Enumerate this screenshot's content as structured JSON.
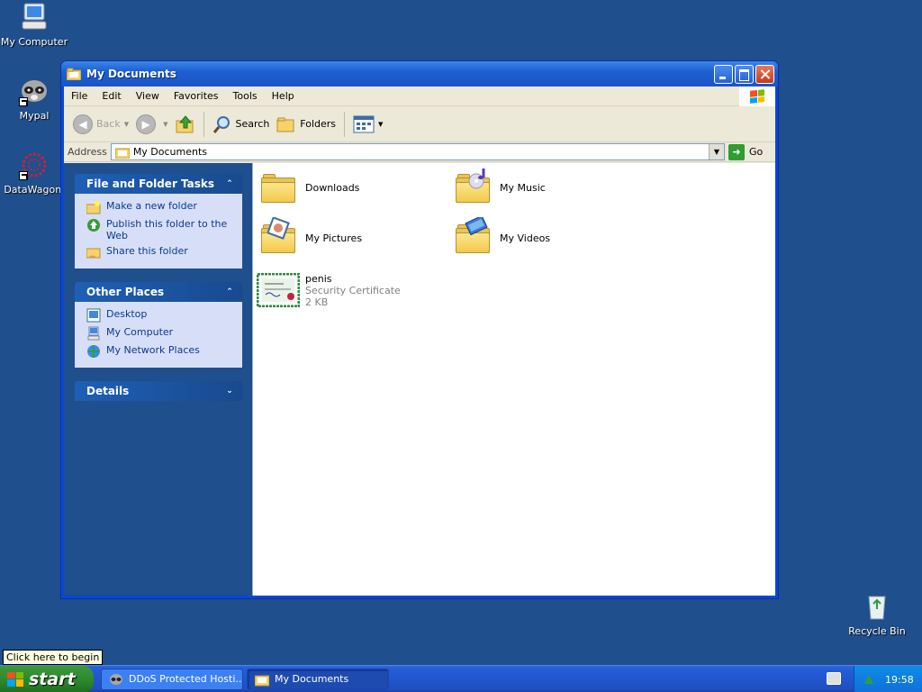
{
  "desktop": {
    "icons": [
      {
        "label": "My Computer",
        "icon": "my-computer-icon"
      },
      {
        "label": "Mypal",
        "icon": "mypal-raccoon-icon"
      },
      {
        "label": "DataWagon.",
        "icon": "datawagon-icon"
      },
      {
        "label": "Recycle Bin",
        "icon": "recycle-bin-icon"
      }
    ]
  },
  "window": {
    "title": "My Documents",
    "menu": [
      "File",
      "Edit",
      "View",
      "Favorites",
      "Tools",
      "Help"
    ],
    "toolbar": {
      "back": "Back",
      "search": "Search",
      "folders": "Folders"
    },
    "address": {
      "label": "Address",
      "value": "My Documents",
      "go": "Go"
    },
    "task_pane": {
      "file_tasks": {
        "title": "File and Folder Tasks",
        "items": [
          "Make a new folder",
          "Publish this folder to the Web",
          "Share this folder"
        ]
      },
      "other_places": {
        "title": "Other Places",
        "items": [
          "Desktop",
          "My Computer",
          "My Network Places"
        ]
      },
      "details": {
        "title": "Details"
      }
    },
    "files": [
      {
        "name": "Downloads",
        "type": "folder"
      },
      {
        "name": "My Music",
        "type": "music-folder"
      },
      {
        "name": "My Pictures",
        "type": "pictures-folder"
      },
      {
        "name": "My Videos",
        "type": "videos-folder"
      },
      {
        "name": "penis",
        "type": "certificate",
        "meta1": "Security Certificate",
        "meta2": "2 KB"
      }
    ]
  },
  "taskbar": {
    "start": "start",
    "tooltip": "Click here to begin",
    "tasks": [
      "DDoS Protected Hosti...",
      "My Documents"
    ],
    "clock": "19:58"
  },
  "colors": {
    "desktop": "#1f4f8c",
    "titlebar": "#1d5fd1",
    "taskbar": "#245edb",
    "start": "#2d8a2d"
  }
}
